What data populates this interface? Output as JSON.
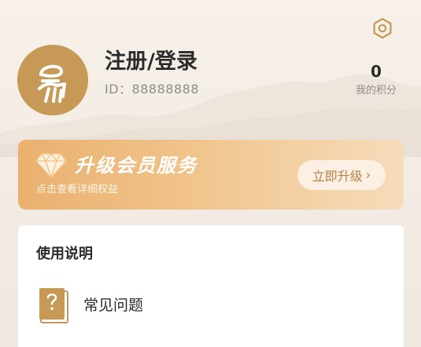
{
  "profile": {
    "username": "注册/登录",
    "id_text": "ID：88888888",
    "points_value": "0",
    "points_label": "我的积分"
  },
  "vip": {
    "title": "升级会员服务",
    "subtitle": "点击查看详细权益",
    "button_label": "立即升级",
    "button_arrow": "›"
  },
  "instructions": {
    "title": "使用说明",
    "items": [
      {
        "label": "常见问题",
        "icon": "question-book-icon"
      }
    ]
  },
  "icons": {
    "settings": "settings-hexagon-icon",
    "avatar": "logo-avatar",
    "vip": "diamond-icon"
  },
  "colors": {
    "accent": "#c69a56",
    "vip_gradient_start": "#eab06e",
    "vip_gradient_end": "#f6dcbb",
    "button_text": "#b88242"
  }
}
